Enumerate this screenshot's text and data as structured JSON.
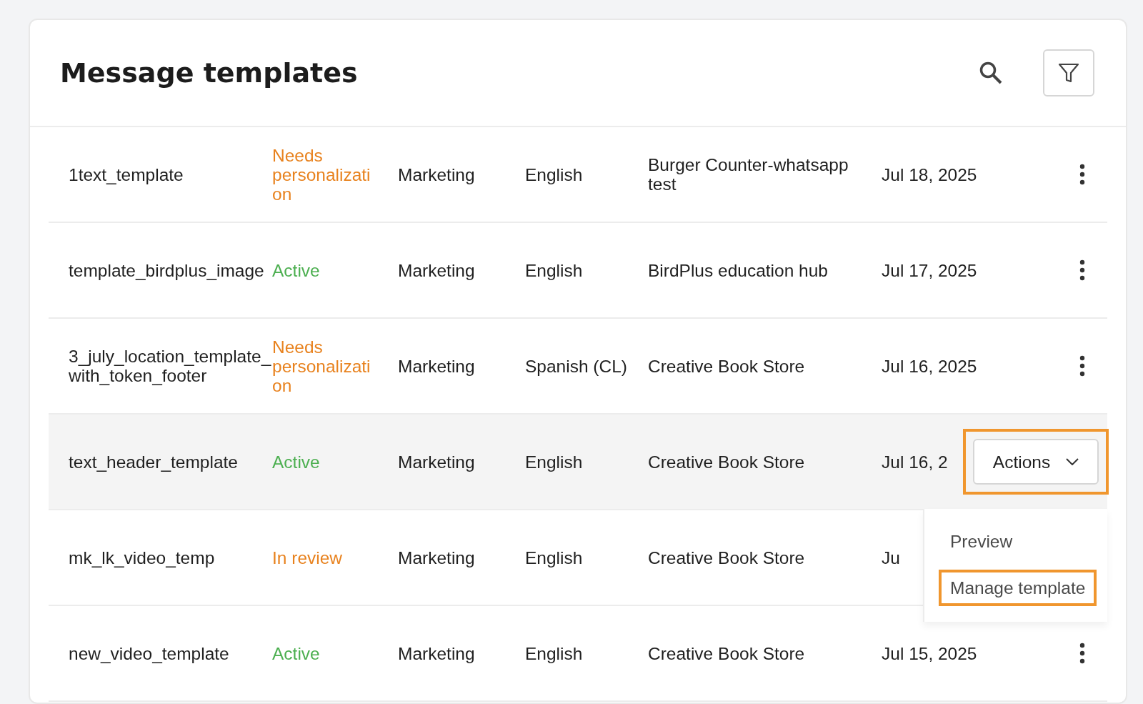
{
  "title": "Message templates",
  "rows": [
    {
      "name": "1text_template",
      "status": "Needs personalization",
      "color": "#e8821e",
      "category": "Marketing",
      "language": "English",
      "account": "Burger Counter-whatsapp test",
      "date": "Jul 18, 2025",
      "kebab": true,
      "selected": false
    },
    {
      "name": "template_birdplus_image",
      "status": "Active",
      "color": "#4caf50",
      "category": "Marketing",
      "language": "English",
      "account": "BirdPlus education hub",
      "date": "Jul 17, 2025",
      "kebab": true,
      "selected": false
    },
    {
      "name": "3_july_location_template_with_token_footer",
      "status": "Needs personalization",
      "color": "#e8821e",
      "category": "Marketing",
      "language": "Spanish (CL)",
      "account": "Creative Book Store",
      "date": "Jul 16, 2025",
      "kebab": true,
      "selected": false
    },
    {
      "name": "text_header_template",
      "status": "Active",
      "color": "#4caf50",
      "category": "Marketing",
      "language": "English",
      "account": "Creative Book Store",
      "date": "Jul 16, 2",
      "kebab": false,
      "selected": true
    },
    {
      "name": "mk_lk_video_temp",
      "status": "In review",
      "color": "#e8821e",
      "category": "Marketing",
      "language": "English",
      "account": "Creative Book Store",
      "date": "Ju",
      "kebab": false,
      "selected": false
    },
    {
      "name": "new_video_template",
      "status": "Active",
      "color": "#4caf50",
      "category": "Marketing",
      "language": "English",
      "account": "Creative Book Store",
      "date": "Jul 15, 2025",
      "kebab": true,
      "selected": false
    }
  ],
  "actions_button": {
    "label": "Actions",
    "highlighted": true
  },
  "menu": {
    "items": [
      {
        "label": "Preview",
        "highlighted": false
      },
      {
        "label": "Manage template",
        "highlighted": true
      }
    ]
  }
}
